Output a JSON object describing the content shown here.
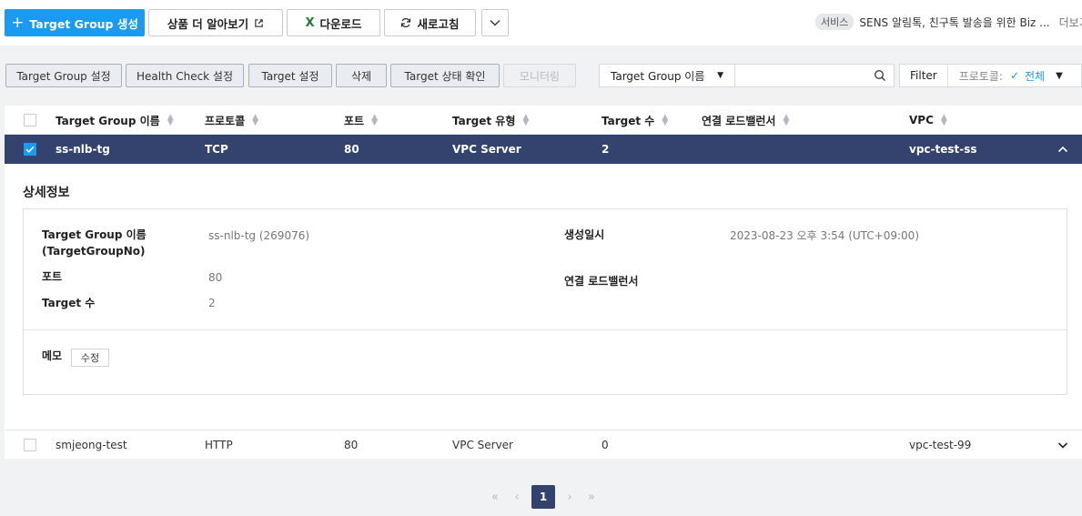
{
  "toolbar": {
    "create": "Target Group 생성",
    "learn_more": "상품 더 알아보기",
    "download": "다운로드",
    "refresh": "새로고침",
    "excel_glyph": "X"
  },
  "notice": {
    "tag": "서비스",
    "text": "SENS 알림톡, 친구톡 발송을 위한 Biz ...",
    "more": "더보기"
  },
  "actions": {
    "tg_settings": "Target Group 설정",
    "hc_settings": "Health Check 설정",
    "target_settings": "Target 설정",
    "delete": "삭제",
    "target_status": "Target 상태 확인",
    "monitoring": "모니터링"
  },
  "search": {
    "field": "Target Group 이름",
    "value": ""
  },
  "filter": {
    "label": "Filter",
    "protocol_label": "프로토콜:",
    "protocol_value": "전체"
  },
  "table": {
    "headers": [
      "Target Group 이름",
      "프로토콜",
      "포트",
      "Target 유형",
      "Target 수",
      "연결 로드밸런서",
      "VPC"
    ],
    "rows": [
      {
        "name": "ss-nlb-tg",
        "protocol": "TCP",
        "port": "80",
        "type": "VPC Server",
        "count": "2",
        "lb": "",
        "vpc": "vpc-test-ss",
        "selected": true
      },
      {
        "name": "smjeong-test",
        "protocol": "HTTP",
        "port": "80",
        "type": "VPC Server",
        "count": "0",
        "lb": "",
        "vpc": "vpc-test-99",
        "selected": false
      }
    ]
  },
  "detail": {
    "title": "상세정보",
    "tg_name_label_1": "Target Group 이름",
    "tg_name_label_2": "(TargetGroupNo)",
    "tg_name_value": "ss-nlb-tg (269076)",
    "port_label": "포트",
    "port_value": "80",
    "count_label": "Target 수",
    "count_value": "2",
    "created_label": "생성일시",
    "created_value": "2023-08-23 오후 3:54 (UTC+09:00)",
    "lb_label": "연결 로드밸런서",
    "lb_value": "",
    "memo_label": "메모",
    "edit": "수정"
  },
  "pagination": {
    "current": "1"
  },
  "colors": {
    "primary": "#1a9bf0",
    "selected_row": "#34426e"
  }
}
